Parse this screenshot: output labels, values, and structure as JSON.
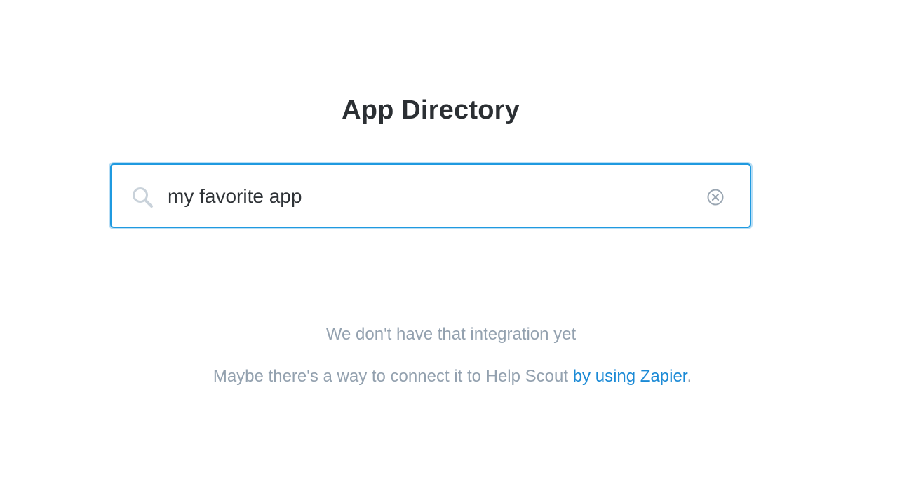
{
  "page": {
    "title": "App Directory"
  },
  "search": {
    "value": "my favorite app",
    "search_icon": "search-icon",
    "clear_icon": "clear-circle-icon"
  },
  "empty_state": {
    "heading": "We don't have that integration yet",
    "text_before_link": "Maybe there's a way to connect it to Help Scout ",
    "link_label": "by using Zapier",
    "text_after_link": "."
  },
  "colors": {
    "accent": "#1f9ae0",
    "link": "#1b8ad6",
    "muted_text": "#93a1af",
    "title_text": "#2b2f33"
  }
}
